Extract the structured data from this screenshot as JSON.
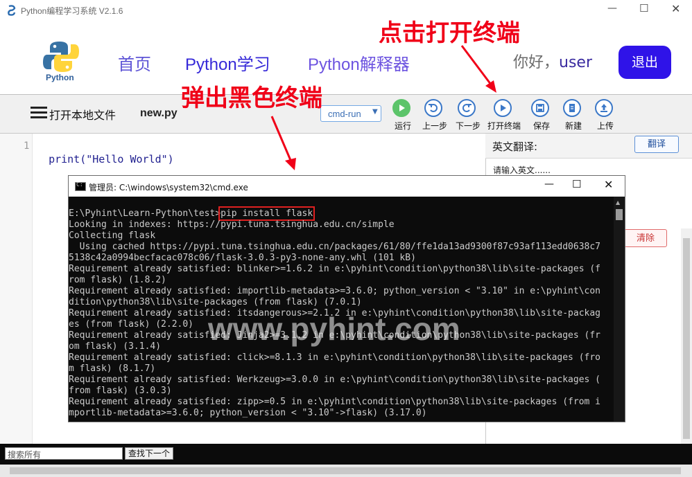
{
  "window": {
    "title": "Python编程学习系统 V2.1.6"
  },
  "header": {
    "logo_text": "Python",
    "nav": [
      "首页",
      "Python学习",
      "Python解释器"
    ],
    "greeting": "你好，",
    "username": "user",
    "logout": "退出"
  },
  "toolbar": {
    "open_file": "打开本地文件",
    "filename": "new.py",
    "run_mode": "cmd-run",
    "buttons": [
      {
        "label": "运行",
        "icon": "play-icon"
      },
      {
        "label": "上一步",
        "icon": "undo-icon"
      },
      {
        "label": "下一步",
        "icon": "redo-icon"
      },
      {
        "label": "打开终端",
        "icon": "terminal-play-icon"
      },
      {
        "label": "保存",
        "icon": "save-icon"
      },
      {
        "label": "新建",
        "icon": "new-file-icon"
      },
      {
        "label": "上传",
        "icon": "upload-icon"
      }
    ]
  },
  "editor": {
    "line_number": "1",
    "code": "print(\"Hello World\")"
  },
  "translate": {
    "title": "英文翻译:",
    "button": "翻译",
    "placeholder": "请输入英文......",
    "clear": "清除"
  },
  "cmd": {
    "title": "管理员: C:\\windows\\system32\\cmd.exe",
    "prompt": "E:\\Pyhint\\Learn-Python\\test>",
    "command": "pip install flask",
    "output": "Looking in indexes: https://pypi.tuna.tsinghua.edu.cn/simple\nCollecting flask\n  Using cached https://pypi.tuna.tsinghua.edu.cn/packages/61/80/ffe1da13ad9300f87c93af113edd0638c7\n5138c42a0994becfacac078c06/flask-3.0.3-py3-none-any.whl (101 kB)\nRequirement already satisfied: blinker>=1.6.2 in e:\\pyhint\\condition\\python38\\lib\\site-packages (f\nrom flask) (1.8.2)\nRequirement already satisfied: importlib-metadata>=3.6.0; python_version < \"3.10\" in e:\\pyhint\\con\ndition\\python38\\lib\\site-packages (from flask) (7.0.1)\nRequirement already satisfied: itsdangerous>=2.1.2 in e:\\pyhint\\condition\\python38\\lib\\site-packag\nes (from flask) (2.2.0)\nRequirement already satisfied: Jinja2>=3.1.2 in e:\\pyhint\\condition\\python38\\lib\\site-packages (fr\nom flask) (3.1.4)\nRequirement already satisfied: click>=8.1.3 in e:\\pyhint\\condition\\python38\\lib\\site-packages (fro\nm flask) (8.1.7)\nRequirement already satisfied: Werkzeug>=3.0.0 in e:\\pyhint\\condition\\python38\\lib\\site-packages (\nfrom flask) (3.0.3)\nRequirement already satisfied: zipp>=0.5 in e:\\pyhint\\condition\\python38\\lib\\site-packages (from i\nmportlib-metadata>=3.6.0; python_version < \"3.10\"->flask) (3.17.0)"
  },
  "search": {
    "placeholder": "搜索所有",
    "find_next": "查找下一个"
  },
  "annotations": {
    "open_terminal": "点击打开终端",
    "popup_terminal": "弹出黑色终端"
  },
  "watermark": "www.pyhint.com",
  "colors": {
    "accent": "#4b2fd0",
    "logout_bg": "#2f13e8",
    "annotation": "#f00018",
    "nav_link": "#3d2be0"
  }
}
